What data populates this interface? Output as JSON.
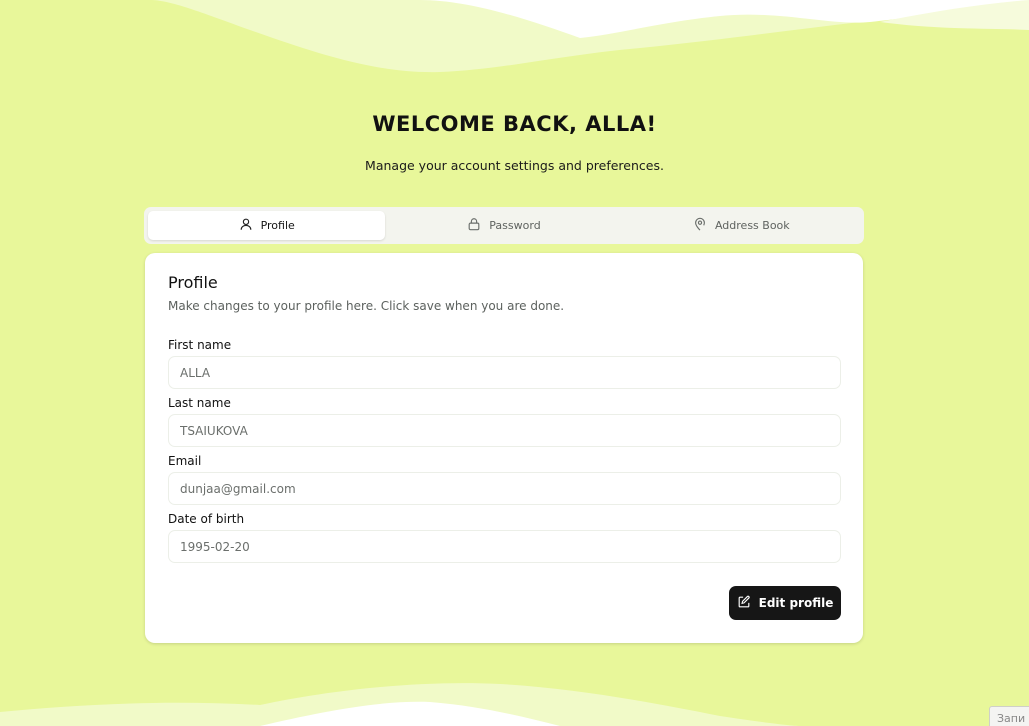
{
  "header": {
    "title": "WELCOME BACK, ALLA!",
    "subtitle": "Manage your account settings and preferences."
  },
  "tabs": [
    {
      "label": "Profile",
      "icon": "user-icon",
      "active": true
    },
    {
      "label": "Password",
      "icon": "lock-icon",
      "active": false
    },
    {
      "label": "Address Book",
      "icon": "map-pin-icon",
      "active": false
    }
  ],
  "profile_card": {
    "title": "Profile",
    "description": "Make changes to your profile here. Click save when you are done.",
    "fields": {
      "first_name": {
        "label": "First name",
        "value": "ALLA"
      },
      "last_name": {
        "label": "Last name",
        "value": "TSAIUKOVA"
      },
      "email": {
        "label": "Email",
        "value": "dunjaa@gmail.com"
      },
      "dob": {
        "label": "Date of birth",
        "value": "1995-02-20"
      }
    },
    "edit_button": {
      "label": "Edit profile",
      "icon": "edit-icon"
    }
  },
  "corner_badge": {
    "label": "Запи"
  },
  "colors": {
    "background": "#e8f79a",
    "wave_light": "#f1fac8",
    "card": "#ffffff",
    "button": "#161616"
  }
}
